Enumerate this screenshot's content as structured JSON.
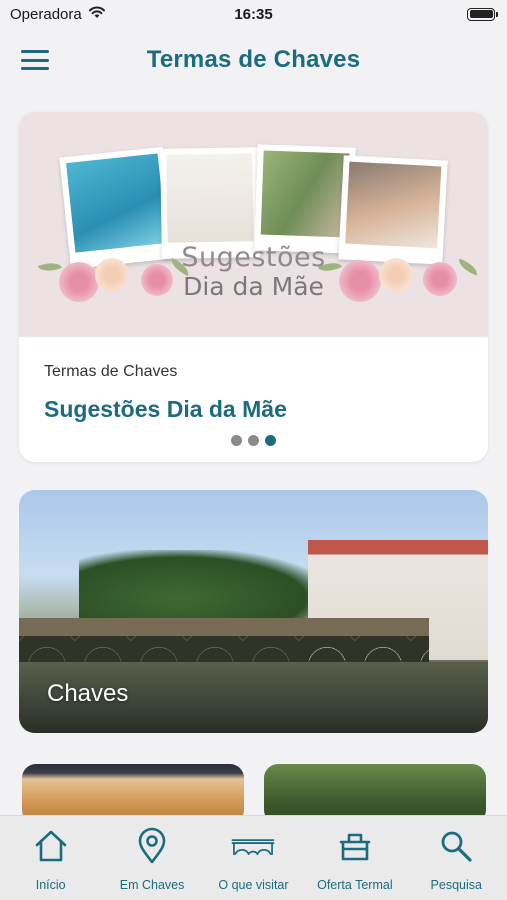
{
  "status_bar": {
    "carrier": "Operadora",
    "time": "16:35"
  },
  "header": {
    "title": "Termas de Chaves",
    "menu_icon": "hamburger-menu-icon"
  },
  "featured": {
    "banner_line1": "Sugestões",
    "banner_line2": "Dia da Mãe",
    "source": "Termas de Chaves",
    "title": "Sugestões Dia da Mãe",
    "pager": {
      "count": 3,
      "active_index": 2
    }
  },
  "city_card": {
    "label": "Chaves"
  },
  "tabs": [
    {
      "label": "Início",
      "icon": "home-icon"
    },
    {
      "label": "Em Chaves",
      "icon": "map-pin-icon"
    },
    {
      "label": "O que visitar",
      "icon": "bridge-icon"
    },
    {
      "label": "Oferta Termal",
      "icon": "basket-icon"
    },
    {
      "label": "Pesquisa",
      "icon": "search-icon"
    }
  ],
  "colors": {
    "accent": "#1d6b80",
    "background": "#f2f2f4",
    "tab_bar": "#eaeaea"
  }
}
